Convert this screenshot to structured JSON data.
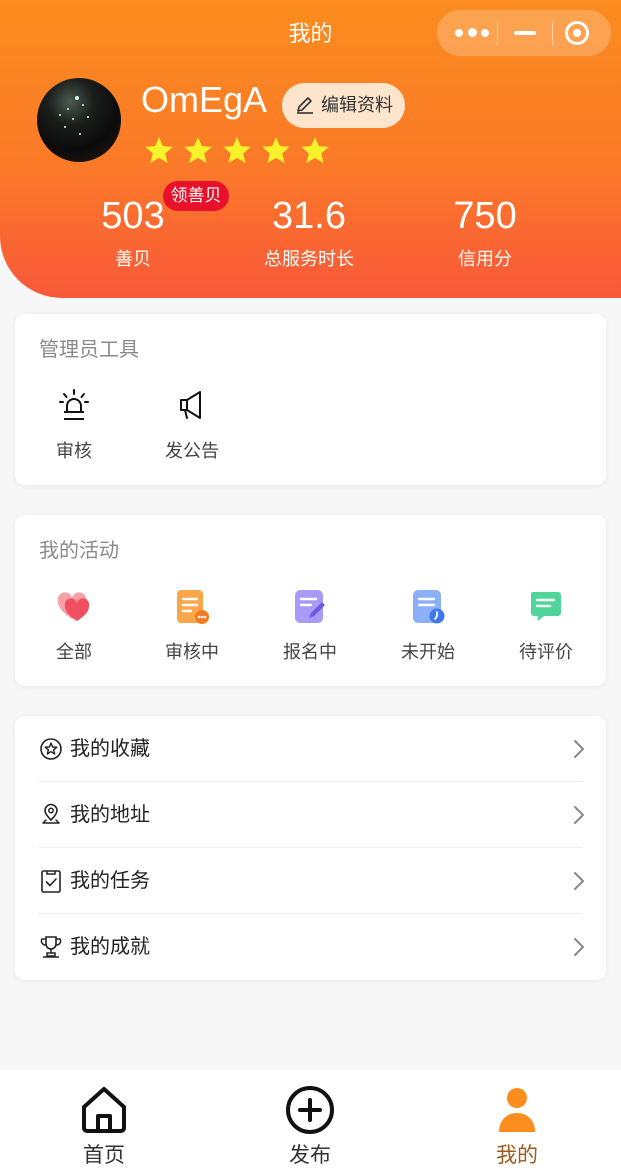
{
  "header": {
    "title": "我的",
    "capsule": {
      "more_icon": "more-dots-icon",
      "minimize_icon": "minimize-icon",
      "close_icon": "target-close-icon"
    }
  },
  "profile": {
    "username": "OmEgA",
    "edit_label": "编辑资料",
    "rating_stars": 5,
    "star_color": "#f7f32a"
  },
  "stats": [
    {
      "value": "503",
      "label": "善贝"
    },
    {
      "value": "31.6",
      "label": "总服务时长"
    },
    {
      "value": "750",
      "label": "信用分"
    }
  ],
  "claim_badge": "领善贝",
  "admin_tools": {
    "title": "管理员工具",
    "items": [
      {
        "label": "审核",
        "icon": "alarm-light-icon"
      },
      {
        "label": "发公告",
        "icon": "megaphone-icon"
      }
    ]
  },
  "activities": {
    "title": "我的活动",
    "items": [
      {
        "label": "全部",
        "icon": "hearts-icon",
        "color": "#ef4f5f"
      },
      {
        "label": "审核中",
        "icon": "document-pending-icon",
        "color": "#fb9a3c"
      },
      {
        "label": "报名中",
        "icon": "document-edit-icon",
        "color": "#9a8cf5"
      },
      {
        "label": "未开始",
        "icon": "document-clock-icon",
        "color": "#5b8ff5"
      },
      {
        "label": "待评价",
        "icon": "chat-bubble-icon",
        "color": "#34c987"
      }
    ]
  },
  "menu": [
    {
      "label": "我的收藏",
      "icon": "star-circle-icon"
    },
    {
      "label": "我的地址",
      "icon": "location-pin-icon"
    },
    {
      "label": "我的任务",
      "icon": "clipboard-check-icon"
    },
    {
      "label": "我的成就",
      "icon": "trophy-icon"
    }
  ],
  "tabbar": {
    "active_color": "#fb8c1e",
    "items": [
      {
        "label": "首页",
        "icon": "home-icon"
      },
      {
        "label": "发布",
        "icon": "plus-circle-icon"
      },
      {
        "label": "我的",
        "icon": "user-icon"
      }
    ]
  }
}
